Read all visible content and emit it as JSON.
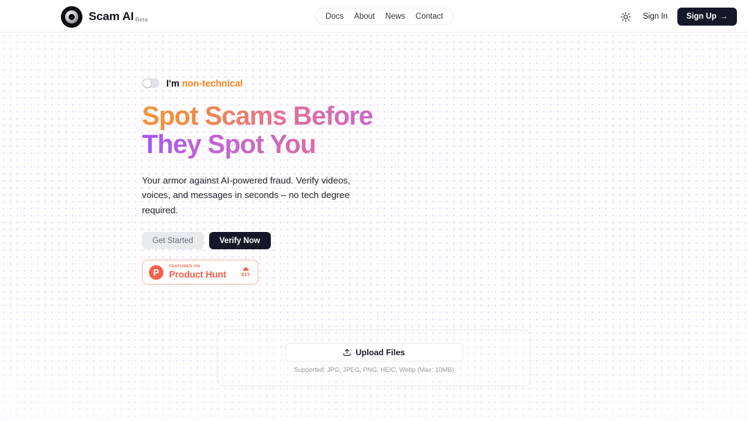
{
  "header": {
    "brand": {
      "name": "Scam AI",
      "beta": "Beta",
      "logo_icon": "eye-icon"
    },
    "nav": [
      {
        "label": "Docs"
      },
      {
        "label": "About"
      },
      {
        "label": "News"
      },
      {
        "label": "Contact"
      }
    ],
    "theme_toggle_icon": "sun-icon",
    "sign_in_label": "Sign In",
    "sign_up_label": "Sign Up",
    "sign_up_arrow": "→"
  },
  "hero": {
    "toggle": {
      "state": "off",
      "prefix": "I'm",
      "accent": "non-technical"
    },
    "headline_line1": "Spot Scams Before",
    "headline_line2": "They Spot You",
    "subcopy": "Your armor against AI-powered fraud. Verify videos, voices, and messages in seconds – no tech degree required.",
    "cta_secondary": "Get Started",
    "cta_primary": "Verify Now",
    "product_hunt": {
      "logo_letter": "P",
      "featured_on": "FEATURED ON",
      "name": "Product Hunt",
      "upvote_icon": "triangle-up-icon",
      "count": "517"
    }
  },
  "upload": {
    "button_label": "Upload Files",
    "button_icon": "upload-icon",
    "hint": "Supported: JPG, JPEG, PNG, HEIC, Webp (Max: 10MB)"
  },
  "colors": {
    "accent_orange": "#f6851f",
    "gradient_start": "#f49539",
    "gradient_mid": "#e0709b",
    "gradient_end": "#a855f7",
    "dark": "#141828",
    "product_hunt_red": "#f4614b",
    "dot_pattern": "#c48cf0"
  }
}
